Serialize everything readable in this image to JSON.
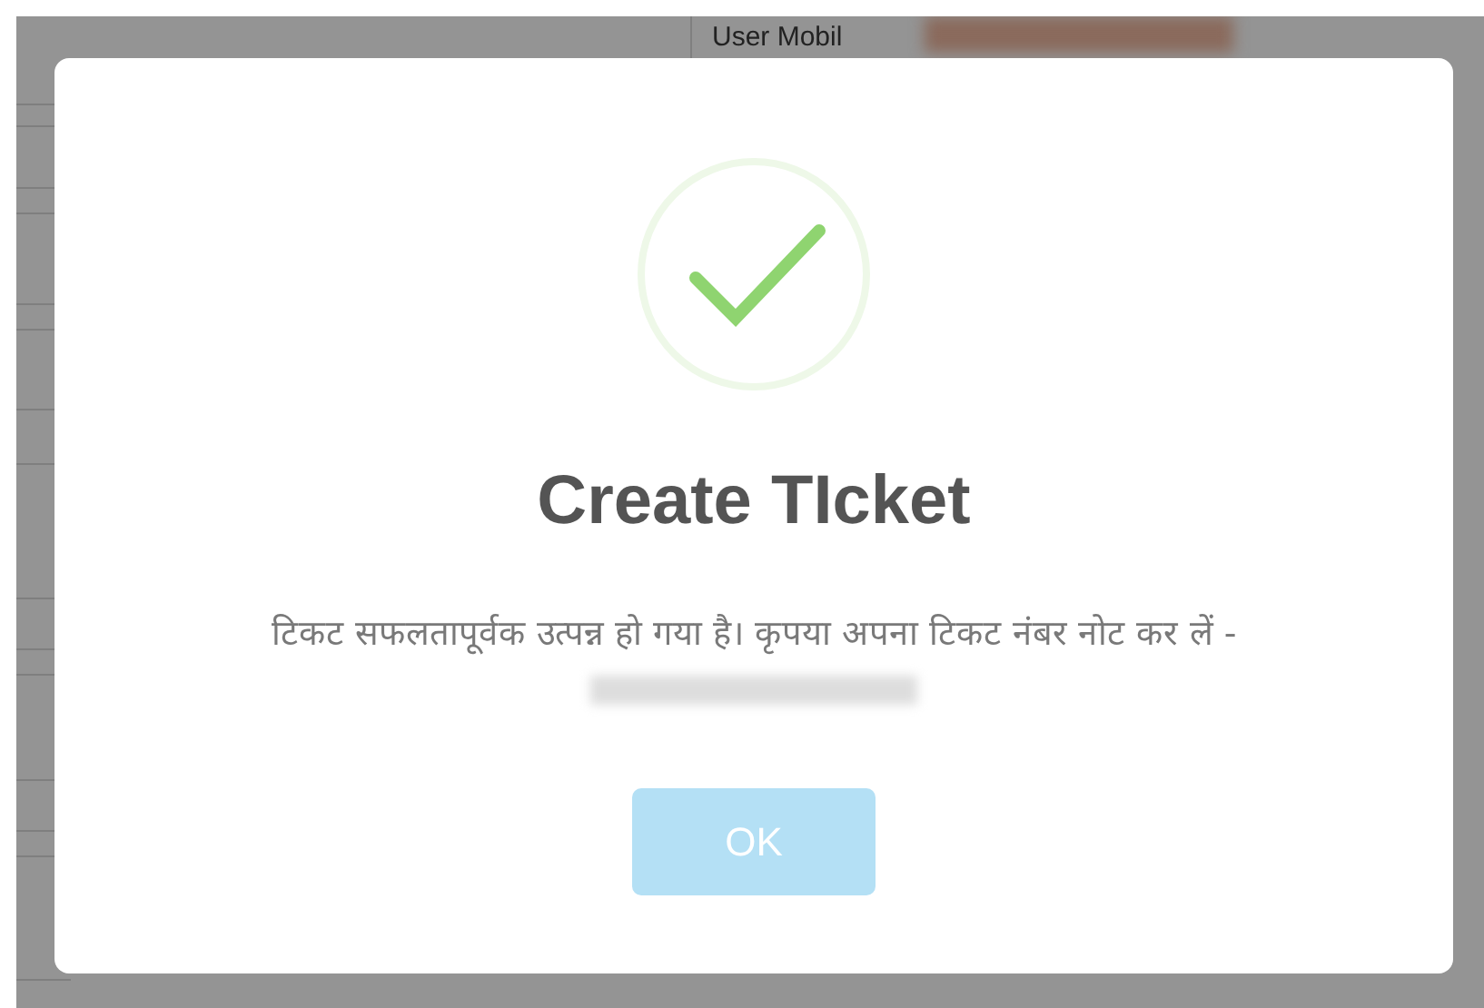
{
  "background_table": {
    "column_header": "User Mobil"
  },
  "dialog": {
    "title": "Create TIcket",
    "message": "टिकट सफलतापूर्वक उत्पन्न हो गया है। कृपया अपना टिकट नंबर नोट कर लें -",
    "ok_button": {
      "label": "OK",
      "disabled": true
    }
  }
}
